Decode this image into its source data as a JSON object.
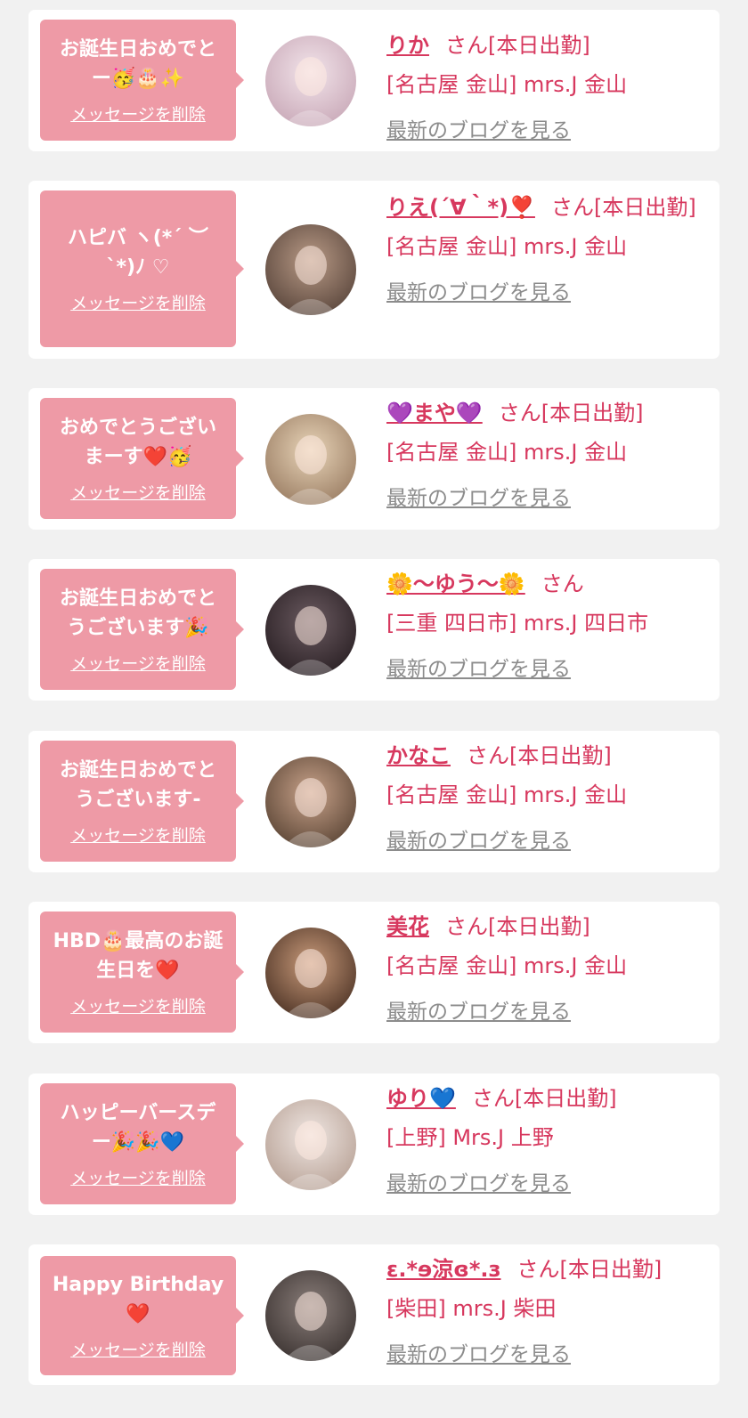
{
  "colors": {
    "background": "#f1f1f1",
    "card": "#ffffff",
    "bubble": "#ee9aa6",
    "accent_text": "#d7385e",
    "link_gray": "#8c8c8c"
  },
  "list": [
    {
      "message": "お誕生日おめでと\nー🥳🎂✨",
      "delete_label": "メッセージを削除",
      "avatar_icon": "avatar-photo-icon",
      "avatar_colors": [
        "#f2e4ea",
        "#c9a9b8"
      ],
      "name": "りか",
      "suffix": "さん",
      "status": "[本日出勤]",
      "shop": "[名古屋 金山] mrs.J 金山",
      "blog_label": "最新のブログを見る"
    },
    {
      "message": "ハピバ ヽ(*´ ︶\n`*)ﾉ ♡",
      "delete_label": "メッセージを削除",
      "avatar_icon": "avatar-photo-icon",
      "avatar_colors": [
        "#b89a86",
        "#5a463c"
      ],
      "name": "りえ(´∀｀*)❣️",
      "suffix": "さん",
      "status": "[本日出勤]",
      "shop": "[名古屋 金山] mrs.J 金山",
      "blog_label": "最新のブログを見る"
    },
    {
      "message": "おめでとうござい\nまーす❤️🥳",
      "delete_label": "メッセージを削除",
      "avatar_icon": "avatar-photo-icon",
      "avatar_colors": [
        "#e8d4b8",
        "#9b7e64"
      ],
      "name": "💜まや💜",
      "suffix": "さん",
      "status": "[本日出勤]",
      "shop": "[名古屋 金山] mrs.J 金山",
      "blog_label": "最新のブログを見る"
    },
    {
      "message": "お誕生日おめでと\nうございます🎉",
      "delete_label": "メッセージを削除",
      "avatar_icon": "avatar-photo-icon",
      "avatar_colors": [
        "#6a5a60",
        "#2a2024"
      ],
      "name": "🌼〜ゆう〜🌼",
      "suffix": "さん",
      "status": "",
      "shop": "[三重 四日市] mrs.J 四日市",
      "blog_label": "最新のブログを見る"
    },
    {
      "message": "お誕生日おめでと\nうございます-",
      "delete_label": "メッセージを削除",
      "avatar_icon": "avatar-photo-icon",
      "avatar_colors": [
        "#c8a28a",
        "#5c4636"
      ],
      "name": "かなこ",
      "suffix": "さん",
      "status": "[本日出勤]",
      "shop": "[名古屋 金山] mrs.J 金山",
      "blog_label": "最新のブログを見る"
    },
    {
      "message": "HBD🎂最高のお誕\n生日を❤️",
      "delete_label": "メッセージを削除",
      "avatar_icon": "avatar-photo-icon",
      "avatar_colors": [
        "#c89a7a",
        "#4e3426"
      ],
      "name": "美花",
      "suffix": "さん",
      "status": "[本日出勤]",
      "shop": "[名古屋 金山] mrs.J 金山",
      "blog_label": "最新のブログを見る"
    },
    {
      "message": "ハッピーバースデ\nー🎉🎉💙",
      "delete_label": "メッセージを削除",
      "avatar_icon": "avatar-photo-icon",
      "avatar_colors": [
        "#efe6e2",
        "#b8a296"
      ],
      "name": "ゆり💙",
      "suffix": "さん",
      "status": "[本日出勤]",
      "shop": "[上野] Mrs.J 上野",
      "blog_label": "最新のブログを見る"
    },
    {
      "message": "Happy Birthday❤️",
      "delete_label": "メッセージを削除",
      "avatar_icon": "avatar-photo-icon",
      "avatar_colors": [
        "#8a7e7a",
        "#3c3432"
      ],
      "name": "ε.*ɘ涼ɞ*.з",
      "suffix": "さん",
      "status": "[本日出勤]",
      "shop": "[柴田] mrs.J 柴田",
      "blog_label": "最新のブログを見る"
    }
  ]
}
